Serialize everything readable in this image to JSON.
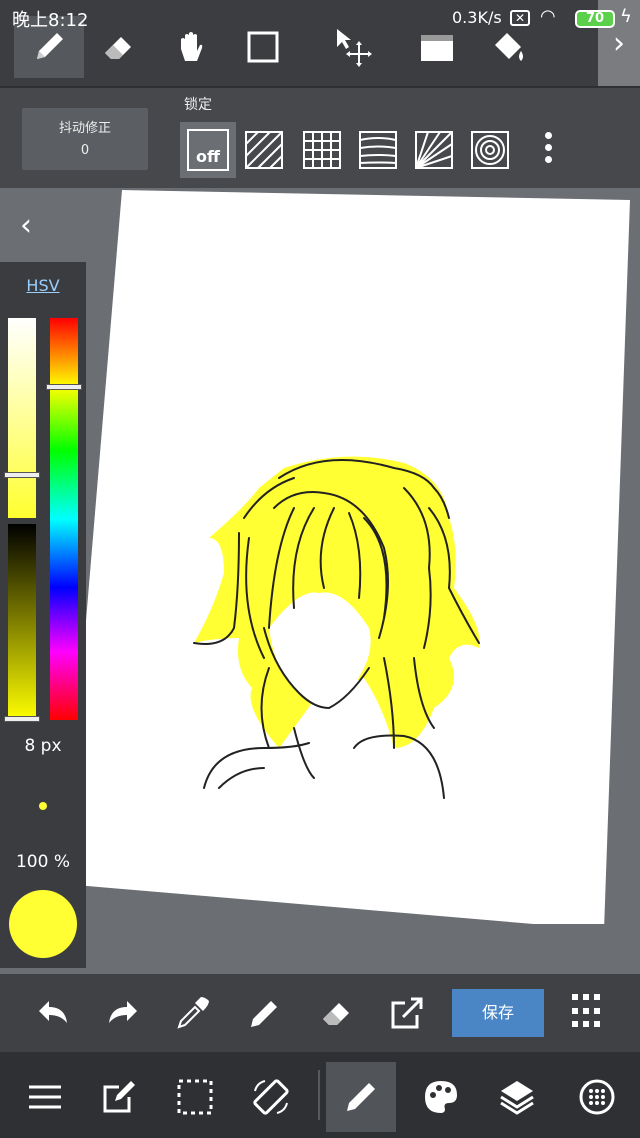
{
  "status_bar": {
    "time": "晚上8:12",
    "net_speed": "0.3K/s",
    "battery": "70"
  },
  "top_toolbar": {
    "tools": [
      "pen-icon",
      "eraser-icon",
      "hand-icon",
      "rectangle-icon",
      "move-icon",
      "fill-icon",
      "bucket-icon"
    ],
    "active_tool": "pen-icon"
  },
  "stabilizer": {
    "label": "抖动修正",
    "value": "0"
  },
  "ruler": {
    "label": "锁定",
    "off_label": "off",
    "options": [
      "off",
      "parallel-lines",
      "grid",
      "concentric-lines",
      "radial-lines",
      "circles"
    ]
  },
  "color_panel": {
    "mode_label": "HSV",
    "brush_size": "8 px",
    "opacity": "100 %",
    "current_color": "#ffff33"
  },
  "action_bar": {
    "save_label": "保存",
    "buttons": [
      "undo-icon",
      "redo-icon",
      "eyedropper-icon",
      "pen-icon",
      "eraser-icon",
      "open-external-icon",
      "grid-menu-icon"
    ]
  },
  "bottom_nav": {
    "buttons": [
      "menu-icon",
      "edit-icon",
      "selection-icon",
      "rotate-icon",
      "brush-icon",
      "palette-icon",
      "layers-icon",
      "material-icon"
    ],
    "active": "brush-icon"
  }
}
